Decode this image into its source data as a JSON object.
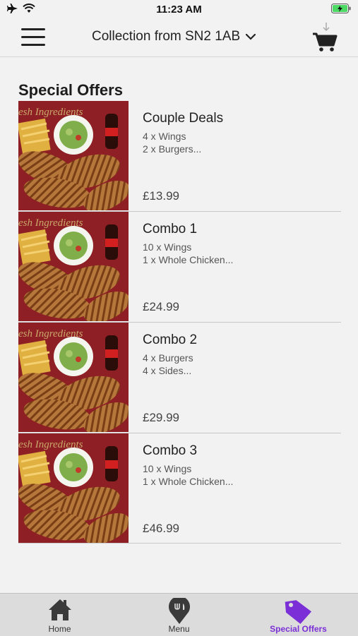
{
  "status_bar": {
    "time": "11:23 AM"
  },
  "header": {
    "collection_label": "Collection from SN2 1AB",
    "icons": [
      "menu-icon",
      "chevron-down-icon",
      "cart-icon"
    ]
  },
  "section": {
    "title": "Special Offers"
  },
  "offers": [
    {
      "name": "Couple Deals",
      "line1": "4 x Wings",
      "line2": "2 x Burgers...",
      "price": "£13.99"
    },
    {
      "name": "Combo 1",
      "line1": "10 x Wings",
      "line2": "1 x Whole Chicken...",
      "price": "£24.99"
    },
    {
      "name": "Combo 2",
      "line1": "4 x Burgers",
      "line2": "4 x Sides...",
      "price": "£29.99"
    },
    {
      "name": "Combo 3",
      "line1": "10 x Wings",
      "line2": "1 x Whole Chicken...",
      "price": "£46.99"
    }
  ],
  "offer_image": {
    "banner_text": "esh Ingredients"
  },
  "tab_bar": {
    "tabs": [
      {
        "label": "Home",
        "icon": "home-icon"
      },
      {
        "label": "Menu",
        "icon": "menu-pin-icon"
      },
      {
        "label": "Special Offers",
        "icon": "tag-icon",
        "active": true
      }
    ]
  },
  "colors": {
    "accent": "#7b2fd6",
    "background": "#f2f2f2",
    "tab_bar": "#dcdcdc"
  }
}
